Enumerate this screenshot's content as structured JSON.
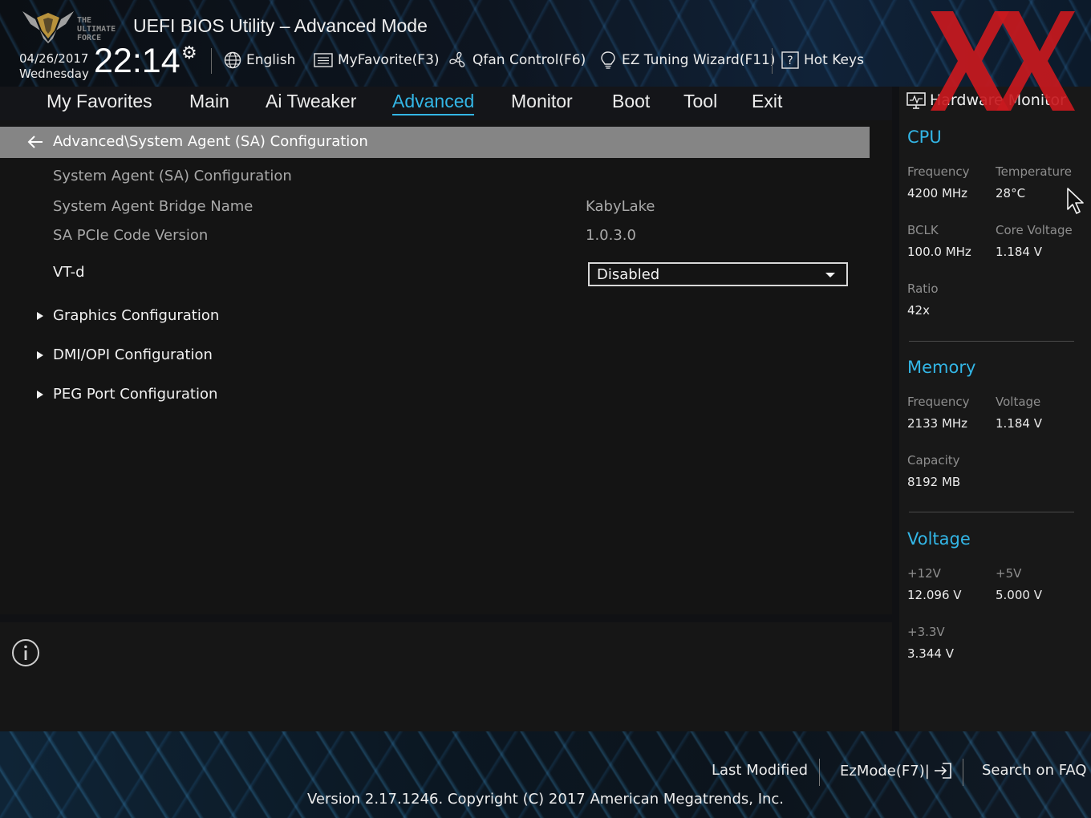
{
  "header": {
    "logo_text": "THE ULTIMATE FORCE",
    "title": "UEFI BIOS Utility – Advanced Mode",
    "date": "04/26/2017",
    "weekday": "Wednesday",
    "time": "22:14",
    "settings_icon": "gear-icon",
    "toolbar": [
      {
        "label": "English",
        "icon": "globe-icon"
      },
      {
        "label": "MyFavorite(F3)",
        "icon": "favorite-list-icon"
      },
      {
        "label": "Qfan Control(F6)",
        "icon": "fan-icon"
      },
      {
        "label": "EZ Tuning Wizard(F11)",
        "icon": "lightbulb-icon"
      },
      {
        "label": "Hot Keys",
        "icon": "help-icon"
      }
    ]
  },
  "watermark": "XX",
  "tabs": [
    {
      "label": "My Favorites",
      "active": false
    },
    {
      "label": "Main",
      "active": false
    },
    {
      "label": "Ai Tweaker",
      "active": false
    },
    {
      "label": "Advanced",
      "active": true
    },
    {
      "label": "Monitor",
      "active": false
    },
    {
      "label": "Boot",
      "active": false
    },
    {
      "label": "Tool",
      "active": false
    },
    {
      "label": "Exit",
      "active": false
    }
  ],
  "main": {
    "breadcrumb": "Advanced\\System Agent (SA) Configuration",
    "section_title": "System Agent (SA) Configuration",
    "rows": [
      {
        "label": "System Agent Bridge Name",
        "value": "KabyLake"
      },
      {
        "label": "SA PCIe Code Version",
        "value": "1.0.3.0"
      }
    ],
    "vtd": {
      "label": "VT-d",
      "value": "Disabled"
    },
    "submenus": [
      "Graphics Configuration",
      "DMI/OPI Configuration",
      "PEG Port Configuration"
    ]
  },
  "hw_monitor": {
    "title": "Hardware Monitor",
    "cpu": {
      "title": "CPU",
      "frequency_label": "Frequency",
      "frequency": "4200 MHz",
      "temperature_label": "Temperature",
      "temperature": "28°C",
      "bclk_label": "BCLK",
      "bclk": "100.0 MHz",
      "core_voltage_label": "Core Voltage",
      "core_voltage": "1.184 V",
      "ratio_label": "Ratio",
      "ratio": "42x"
    },
    "memory": {
      "title": "Memory",
      "frequency_label": "Frequency",
      "frequency": "2133 MHz",
      "voltage_label": "Voltage",
      "voltage": "1.184 V",
      "capacity_label": "Capacity",
      "capacity": "8192 MB"
    },
    "voltage": {
      "title": "Voltage",
      "v12_label": "+12V",
      "v12": "12.096 V",
      "v5_label": "+5V",
      "v5": "5.000 V",
      "v33_label": "+3.3V",
      "v33": "3.344 V"
    }
  },
  "footer": {
    "last_modified": "Last Modified",
    "ezmode": "EzMode(F7)|",
    "search_faq": "Search on FAQ",
    "version": "Version 2.17.1246. Copyright (C) 2017 American Megatrends, Inc."
  },
  "colors": {
    "accent": "#33b6e6",
    "breadcrumb_bg": "#858585",
    "watermark": "#c8191e"
  }
}
